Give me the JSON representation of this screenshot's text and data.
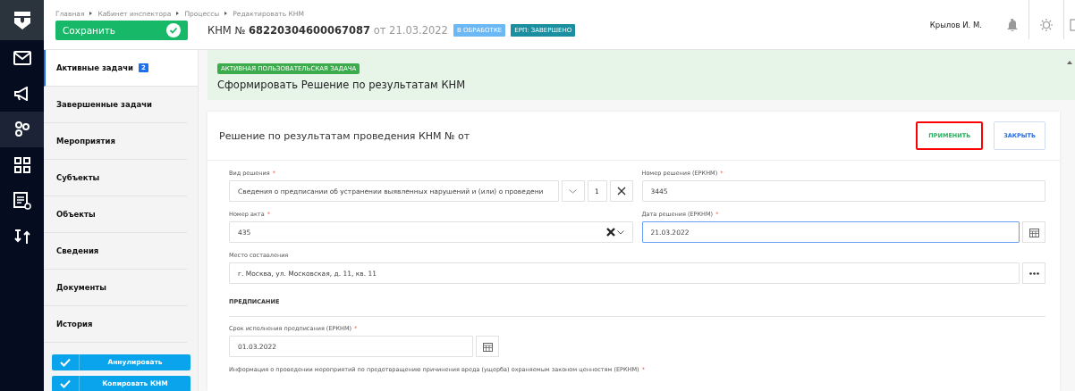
{
  "header": {
    "breadcrumbs": [
      "Главная",
      "Кабинет инспектора",
      "Процессы",
      "Редактировать КНМ"
    ],
    "save_button": "Сохранить",
    "title": {
      "prefix": "КНМ №",
      "number": "68220304600067087",
      "date": "от 21.03.2022"
    },
    "badges": [
      {
        "label": "В ОБРАБОТКЕ",
        "color": "#6cb8f5"
      },
      {
        "label": "ЕРП: ЗАВЕРШЕНО",
        "color": "#1a8fa0"
      }
    ],
    "user": "Крылов И. М."
  },
  "rail": [
    {
      "kind": "mail",
      "selected": false
    },
    {
      "kind": "megaphone",
      "selected": false
    },
    {
      "kind": "gears",
      "selected": true
    },
    {
      "kind": "grid",
      "selected": false
    },
    {
      "kind": "document",
      "selected": false
    },
    {
      "kind": "sort",
      "selected": false
    }
  ],
  "sidebar": {
    "items": [
      {
        "label": "Активные задачи",
        "badge": "2",
        "selected": true
      },
      {
        "label": "Завершенные задачи",
        "selected": false
      },
      {
        "label": "Мероприятия",
        "selected": false
      },
      {
        "label": "Субъекты",
        "selected": false
      },
      {
        "label": "Объекты",
        "selected": false
      },
      {
        "label": "Сведения",
        "selected": false
      },
      {
        "label": "Документы",
        "selected": false
      },
      {
        "label": "История",
        "selected": false
      }
    ],
    "actions": [
      "Аннулировать",
      "Копировать КНМ"
    ]
  },
  "task": {
    "tag": "АКТИВНАЯ ПОЛЬЗОВАТЕЛЬСКАЯ ЗАДАЧА",
    "title": "Сформировать Решение по результатам КНМ"
  },
  "card": {
    "title": "Решение по результатам проведения КНМ № от",
    "buttons": [
      {
        "label": "ПРИМЕНИТЬ",
        "highlighted": true
      },
      {
        "label": "ЗАКРЫТЬ",
        "highlighted": false
      }
    ],
    "form": [
      {
        "kind": "pair",
        "fields": [
          {
            "kind": "select",
            "label": "Вид решения",
            "mark": "*",
            "value": "Сведения о предписании об устранении выявленных нарушений и (или) о проведени",
            "counter": "1",
            "focused": false
          },
          {
            "kind": "text",
            "label": "Номер решения (ЕРКНМ)",
            "mark": "*",
            "value": "3445",
            "focused": false
          }
        ]
      },
      {
        "kind": "pair",
        "fields": [
          {
            "kind": "combo",
            "label": "Номер акта",
            "mark": "*",
            "value": "435",
            "focused": false
          },
          {
            "kind": "date",
            "label": "Дата решения (ЕРКНМ)",
            "mark": "*",
            "value": "21.03.2022",
            "focused": true
          }
        ]
      },
      {
        "kind": "full",
        "fields": [
          {
            "kind": "lookup",
            "label": "Место составления",
            "value": "г. Москва, ул. Московская, д. 11, кв. 11",
            "focused": false
          }
        ]
      },
      {
        "kind": "section",
        "label": "ПРЕДПИСАНИЕ"
      },
      {
        "kind": "narrow",
        "fields": [
          {
            "kind": "date",
            "label": "Срок исполнения предписания (ЕРКНМ)",
            "mark": "*",
            "value": "01.03.2022",
            "focused": false
          }
        ]
      },
      {
        "kind": "caption",
        "label": "Информация о проведении мероприятий по предотвращению причинения вреда (ущерба) охраняемым законом ценностям (ЕРКНМ)",
        "mark": "*"
      }
    ]
  }
}
